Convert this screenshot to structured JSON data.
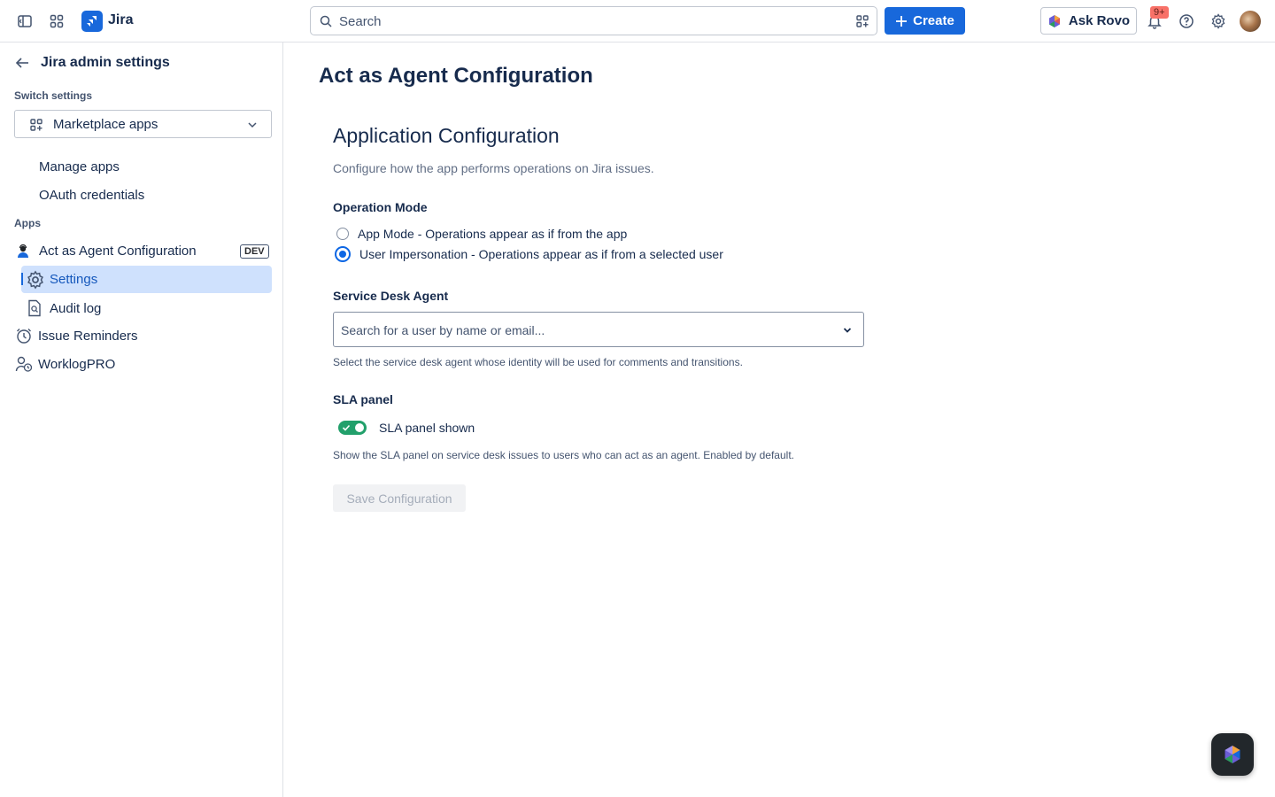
{
  "topnav": {
    "app_name": "Jira",
    "search_placeholder": "Search",
    "create_label": "Create",
    "rovo_label": "Ask Rovo",
    "notification_badge": "9+"
  },
  "sidebar": {
    "title": "Jira admin settings",
    "switch_settings_label": "Switch settings",
    "switcher_value": "Marketplace apps",
    "items": [
      {
        "label": "Manage apps"
      },
      {
        "label": "OAuth credentials"
      }
    ],
    "apps_label": "Apps",
    "apps": [
      {
        "label": "Act as Agent Configuration",
        "tag": "DEV"
      },
      {
        "label": "Settings"
      },
      {
        "label": "Audit log"
      },
      {
        "label": "Issue Reminders"
      },
      {
        "label": "WorklogPRO"
      }
    ]
  },
  "main": {
    "page_title": "Act as Agent Configuration",
    "app_title": "Application Configuration",
    "description": "Configure how the app performs operations on Jira issues.",
    "operation_mode": {
      "label": "Operation Mode",
      "options": [
        {
          "label": "App Mode - Operations appear as if from the app",
          "checked": false
        },
        {
          "label": "User Impersonation - Operations appear as if from a selected user",
          "checked": true
        }
      ]
    },
    "service_desk": {
      "label": "Service Desk Agent",
      "placeholder": "Search for a user by name or email...",
      "helper": "Select the service desk agent whose identity will be used for comments and transitions."
    },
    "sla": {
      "label": "SLA panel",
      "toggle_label": "SLA panel shown",
      "toggle_on": true,
      "helper": "Show the SLA panel on service desk issues to users who can act as an agent. Enabled by default."
    },
    "save_label": "Save Configuration"
  },
  "colors": {
    "brand": "#1868db",
    "selected_bg": "#cfe1fd",
    "toggle_on": "#22a06b"
  }
}
